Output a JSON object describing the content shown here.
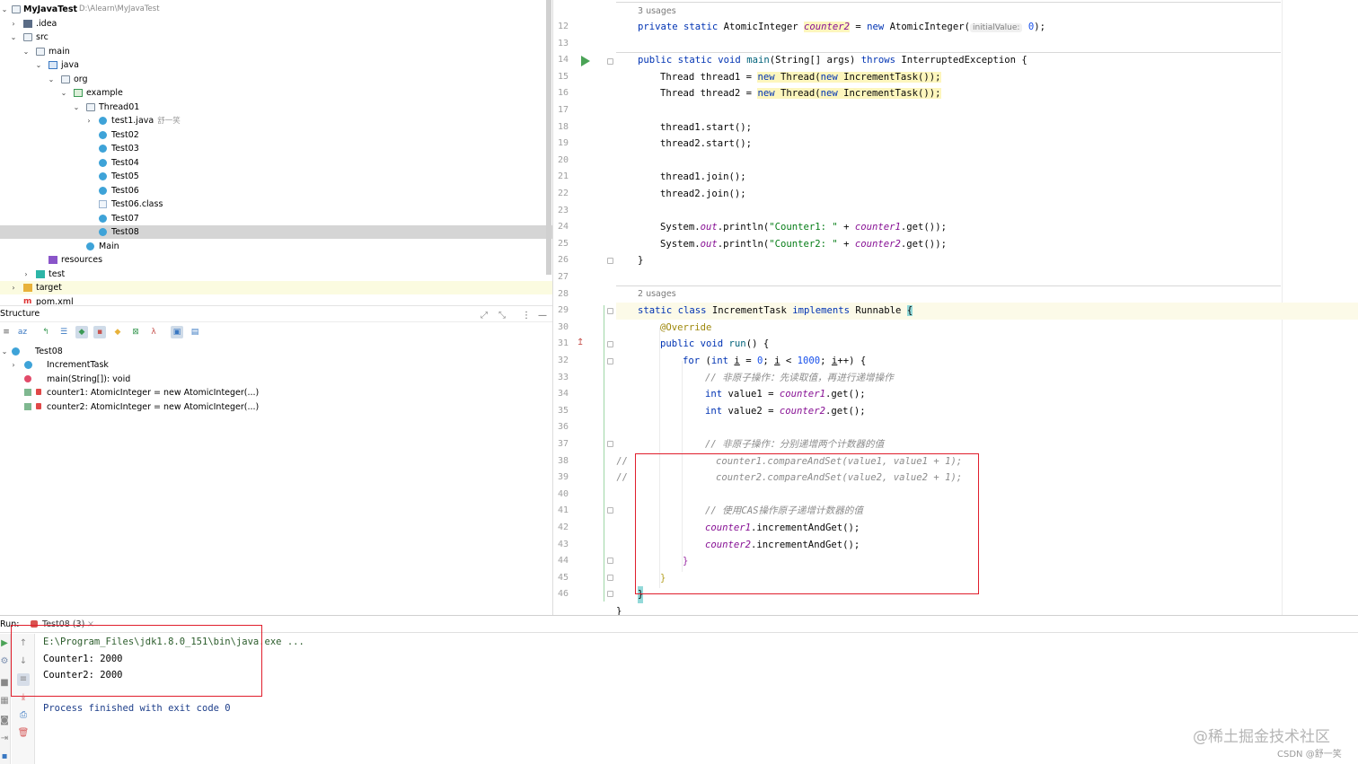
{
  "project": {
    "root_name": "MyJavaTest",
    "root_path": "D:\\Alearn\\MyJavaTest",
    "items": [
      {
        "label": ".idea"
      },
      {
        "label": "src"
      },
      {
        "label": "main"
      },
      {
        "label": "java"
      },
      {
        "label": "org"
      },
      {
        "label": "example"
      },
      {
        "label": "Thread01"
      },
      {
        "label": "test1.java",
        "author": "舒一笑"
      },
      {
        "label": "Test02"
      },
      {
        "label": "Test03"
      },
      {
        "label": "Test04"
      },
      {
        "label": "Test05"
      },
      {
        "label": "Test06"
      },
      {
        "label": "Test06.class"
      },
      {
        "label": "Test07"
      },
      {
        "label": "Test08"
      },
      {
        "label": "Main"
      },
      {
        "label": "resources"
      },
      {
        "label": "test"
      },
      {
        "label": "target"
      },
      {
        "label": "pom.xml"
      }
    ]
  },
  "structure": {
    "title": "Structure",
    "items": [
      {
        "label": "Test08"
      },
      {
        "label": "IncrementTask"
      },
      {
        "label": "main(String[]): void"
      },
      {
        "label": "counter1: AtomicInteger = new AtomicInteger(...)"
      },
      {
        "label": "counter2: AtomicInteger = new AtomicInteger(...)"
      }
    ]
  },
  "editor": {
    "usages_1": "3 usages",
    "usages_2": "2 usages",
    "line_numbers": [
      "12",
      "13",
      "14",
      "15",
      "16",
      "17",
      "18",
      "19",
      "20",
      "21",
      "22",
      "23",
      "24",
      "25",
      "26",
      "27",
      "28",
      "29",
      "30",
      "31",
      "32",
      "33",
      "34",
      "35",
      "36",
      "37",
      "38",
      "39",
      "40",
      "41",
      "42",
      "43",
      "44",
      "45",
      "46"
    ],
    "param_hint": "initialValue:",
    "tokens": {
      "l12a": "private static ",
      "l12b": "AtomicInteger ",
      "l12c": "counter2",
      "l12d": " = ",
      "l12e": "new ",
      "l12f": "AtomicInteger(",
      "l12g": "0",
      "l12h": ");",
      "l14a": "public static void ",
      "l14b": "main",
      "l14c": "(String[] args) ",
      "l14d": "throws ",
      "l14e": "InterruptedException {",
      "l15a": "Thread thread1 = ",
      "l15b": "new ",
      "l15c": "Thread(",
      "l15d": "new ",
      "l15e": "IncrementTask",
      "l15f": "());",
      "l16a": "Thread thread2 = ",
      "l16b": "new ",
      "l16c": "Thread(",
      "l16d": "new ",
      "l16e": "IncrementTask",
      "l16f": "());",
      "l18": "thread1.start();",
      "l19": "thread2.start();",
      "l21": "thread1.join();",
      "l22": "thread2.join();",
      "l24a": "System.",
      "l24b": "out",
      "l24c": ".println(",
      "l24d": "\"Counter1: \"",
      "l24e": " + ",
      "l24f": "counter1",
      "l24g": ".get());",
      "l25a": "System.",
      "l25b": "out",
      "l25c": ".println(",
      "l25d": "\"Counter2: \"",
      "l25e": " + ",
      "l25f": "counter2",
      "l25g": ".get());",
      "l26": "}",
      "l28a": "static class ",
      "l28b": "IncrementTask ",
      "l28c": "implements ",
      "l28d": "Runnable ",
      "l28e": "{",
      "l29": "@Override",
      "l30a": "public void ",
      "l30b": "run",
      "l30c": "() {",
      "l31a": "for ",
      "l31b": "(",
      "l31c": "int ",
      "l31d": "i",
      "l31e": " = ",
      "l31f": "0",
      "l31g": "; ",
      "l31h": "i",
      "l31i": " < ",
      "l31j": "1000",
      "l31k": "; ",
      "l31l": "i",
      "l31m": "++) {",
      "l32": "// 非原子操作：先读取值，再进行递增操作",
      "l33a": "int ",
      "l33b": "value1 = ",
      "l33c": "counter1",
      "l33d": ".get();",
      "l34a": "int ",
      "l34b": "value2 = ",
      "l34c": "counter2",
      "l34d": ".get();",
      "l36": "// 非原子操作：分别递增两个计数器的值",
      "l37a": "//",
      "l37b": "counter1.compareAndSet(value1, value1 + 1);",
      "l38a": "//",
      "l38b": "counter2.compareAndSet(value2, value2 + 1);",
      "l40": "// 使用CAS操作原子递增计数器的值",
      "l41a": "counter1",
      "l41b": ".incrementAndGet();",
      "l42a": "counter2",
      "l42b": ".incrementAndGet();",
      "l43": "}",
      "l44": "}",
      "l45": "}",
      "l46": "}"
    }
  },
  "run": {
    "label": "Run:",
    "tab": "Test08 (3)",
    "lines": [
      "E:\\Program_Files\\jdk1.8.0_151\\bin\\java.exe ...",
      "Counter1: 2000",
      "Counter2: 2000",
      "Process finished with exit code 0"
    ]
  },
  "watermark": {
    "main": "@稀土掘金技术社区",
    "sub": "CSDN @舒一笑"
  },
  "colors": {
    "keyword": "#0033b3",
    "field": "#871094",
    "string": "#067d17",
    "number": "#1750eb",
    "comment": "#8c8c8c",
    "annotation_box": "#e01e2c",
    "selection": "#d5d5d5"
  }
}
